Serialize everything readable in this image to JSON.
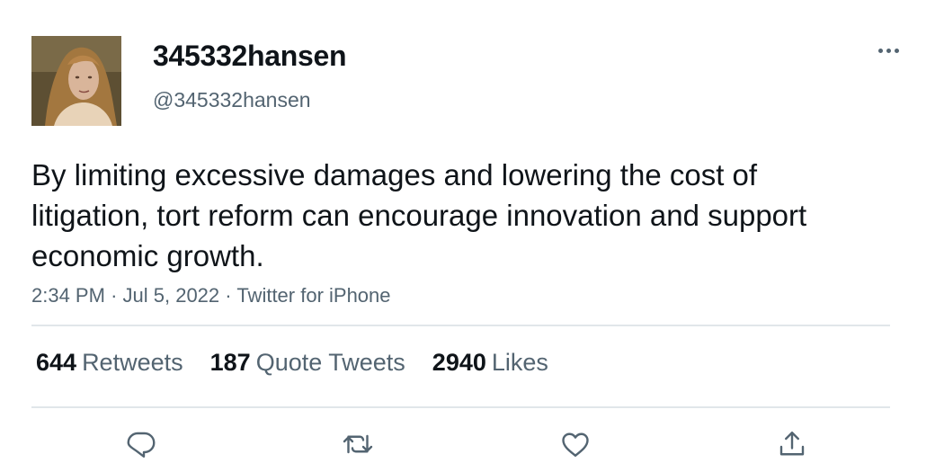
{
  "user": {
    "display_name": "345332hansen",
    "handle": "@345332hansen"
  },
  "tweet": {
    "text": "By limiting excessive damages and lowering the cost of litigation, tort reform can encourage innovation and support economic growth.",
    "time": "2:34 PM",
    "separator": "·",
    "date": "Jul 5, 2022",
    "source": "Twitter for iPhone"
  },
  "stats": {
    "retweets_count": "644",
    "retweets_label": "Retweets",
    "quotes_count": "187",
    "quotes_label": "Quote Tweets",
    "likes_count": "2940",
    "likes_label": "Likes"
  },
  "actions": {
    "reply_icon": "reply-icon",
    "retweet_icon": "retweet-icon",
    "like_icon": "heart-icon",
    "share_icon": "share-icon"
  },
  "colors": {
    "text": "#0f1419",
    "secondary": "#536471",
    "divider": "#e1e6ea"
  }
}
